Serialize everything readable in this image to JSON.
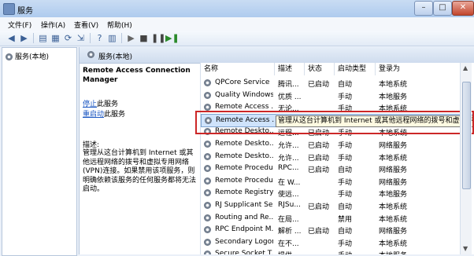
{
  "window": {
    "title": "服务"
  },
  "menu": [
    {
      "label": "文件(F)"
    },
    {
      "label": "操作(A)"
    },
    {
      "label": "查看(V)"
    },
    {
      "label": "帮助(H)"
    }
  ],
  "tree": {
    "item": "服务(本地)"
  },
  "main": {
    "header": "服务(本地)"
  },
  "detail": {
    "service_name": "Remote Access Connection Manager",
    "stop_link": "停止",
    "stop_suffix": "此服务",
    "restart_link": "重启动",
    "restart_suffix": "此服务",
    "desc_title": "描述:",
    "desc_text": "管理从这台计算机到 Internet 或其他远程网络的拨号和虚拟专用网络(VPN)连接。如果禁用该项服务，则明确依赖该服务的任何服务都将无法启动。"
  },
  "columns": [
    "名称",
    "描述",
    "状态",
    "启动类型",
    "登录为"
  ],
  "rows": [
    {
      "name": "QPCore Service",
      "desc": "腾讯...",
      "status": "已启动",
      "startup": "自动",
      "logon": "本地系统"
    },
    {
      "name": "Quality Windows...",
      "desc": "优质 ...",
      "status": "",
      "startup": "手动",
      "logon": "本地服务"
    },
    {
      "name": "Remote Access ...",
      "desc": "无论...",
      "status": "",
      "startup": "手动",
      "logon": "本地系统"
    },
    {
      "name": "Remote Access ...",
      "desc": "管理从这台计算机到 Internet 或其他远程网络的拨号和虚拟专用",
      "status": "",
      "startup": "",
      "logon": ""
    },
    {
      "name": "Remote Deskto...",
      "desc": "远程...",
      "status": "已启动",
      "startup": "手动",
      "logon": "本地系统"
    },
    {
      "name": "Remote Deskto...",
      "desc": "允许...",
      "status": "已启动",
      "startup": "手动",
      "logon": "网络服务"
    },
    {
      "name": "Remote Deskto...",
      "desc": "允许...",
      "status": "已启动",
      "startup": "手动",
      "logon": "本地系统"
    },
    {
      "name": "Remote Procedu...",
      "desc": "RPC...",
      "status": "已启动",
      "startup": "自动",
      "logon": "网络服务"
    },
    {
      "name": "Remote Procedu...",
      "desc": "在 W...",
      "status": "",
      "startup": "手动",
      "logon": "网络服务"
    },
    {
      "name": "Remote Registry",
      "desc": "使远...",
      "status": "",
      "startup": "手动",
      "logon": "本地服务"
    },
    {
      "name": "RJ Supplicant Se...",
      "desc": "RJSu...",
      "status": "已启动",
      "startup": "自动",
      "logon": "本地系统"
    },
    {
      "name": "Routing and Re...",
      "desc": "在局...",
      "status": "",
      "startup": "禁用",
      "logon": "本地系统"
    },
    {
      "name": "RPC Endpoint M...",
      "desc": "解析 ...",
      "status": "已启动",
      "startup": "自动",
      "logon": "网络服务"
    },
    {
      "name": "Secondary Logon",
      "desc": "在不...",
      "status": "",
      "startup": "手动",
      "logon": "本地系统"
    },
    {
      "name": "Secure Socket T...",
      "desc": "提供...",
      "status": "",
      "startup": "手动",
      "logon": "本地服务"
    }
  ],
  "tooltip": "管理从这台计算机到 Internet 或其他远程网络的拨号和虚拟专用网",
  "colors": {
    "selection": "#cfe3fb",
    "highlight_box": "#cc2727",
    "link": "#1a56c2"
  }
}
